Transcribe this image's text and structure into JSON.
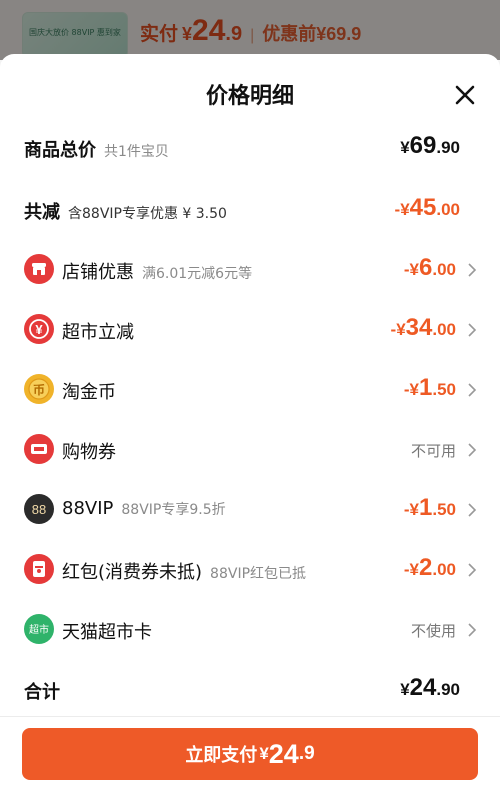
{
  "background": {
    "thumb_text": "国庆大放价 88VIP 惠到家",
    "pay_label": "实付",
    "pay_yen": "¥",
    "pay_int": "24",
    "pay_dec": ".9",
    "separator": "|",
    "orig_label": "优惠前¥69.9"
  },
  "sheet": {
    "title": "价格明细",
    "close_icon": "close-icon"
  },
  "rows": [
    {
      "label": "商品总价",
      "sub": "共1件宝贝",
      "yen": "¥",
      "int": "69",
      "dec": ".90",
      "color": "#111111"
    },
    {
      "label": "共减",
      "sub": "含88VIP专享优惠 ¥ 3.50",
      "yen": "-¥",
      "int": "45",
      "dec": ".00",
      "color": "#ee5a24"
    },
    {
      "label": "店铺优惠",
      "sub": "满6.01元减6元等",
      "yen": "-¥",
      "int": "6",
      "dec": ".00",
      "icon": "shop-icon",
      "icon_color": "#e53a3a"
    },
    {
      "label": "超市立减",
      "sub": "",
      "yen": "-¥",
      "int": "34",
      "dec": ".00",
      "icon": "yen-discount-icon",
      "icon_color": "#e53a3a"
    },
    {
      "label": "淘金币",
      "sub": "",
      "yen": "-¥",
      "int": "1",
      "dec": ".50",
      "icon": "gold-coin-icon",
      "icon_color": "#f0b32a"
    },
    {
      "label": "购物券",
      "sub": "",
      "status": "不可用",
      "icon": "coupon-icon",
      "icon_color": "#e53a3a"
    },
    {
      "label": "88VIP",
      "sub": "88VIP专享9.5折",
      "yen": "-¥",
      "int": "1",
      "dec": ".50",
      "icon": "vip-88-icon",
      "icon_color": "#2b2b2b"
    },
    {
      "label": "红包(消费券未抵)",
      "sub": "88VIP红包已抵",
      "yen": "-¥",
      "int": "2",
      "dec": ".00",
      "icon": "red-packet-icon",
      "icon_color": "#e53a3a"
    },
    {
      "label": "天猫超市卡",
      "sub": "",
      "status": "不使用",
      "icon": "supermarket-card-icon",
      "icon_color": "#2fb36a",
      "icon_text": "超市"
    },
    {
      "label": "合计",
      "sub": "",
      "yen": "¥",
      "int": "24",
      "dec": ".90",
      "color": "#111111"
    }
  ],
  "pay_button": {
    "label": "立即支付",
    "yen": "¥",
    "int": "24",
    "dec": ".9"
  },
  "colors": {
    "accent": "#ee5a28",
    "discount": "#ee5a24"
  }
}
